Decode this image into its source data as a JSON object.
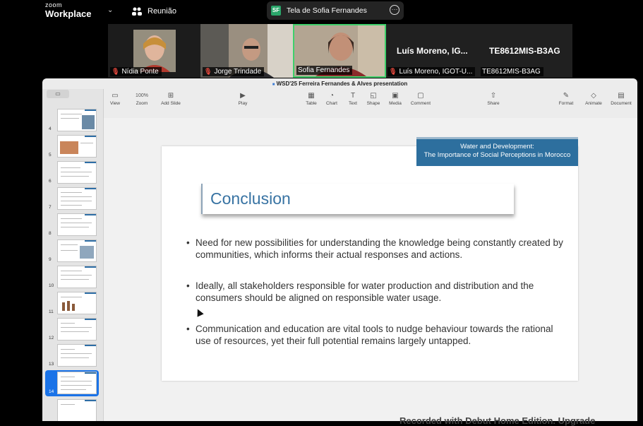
{
  "app": {
    "logo_small": "zoom",
    "logo_big": "Workplace"
  },
  "meeting": {
    "label": "Reunião",
    "chevron": "⌄"
  },
  "screen_share": {
    "badge": "SF",
    "label": "Tela de Sofia Fernandes",
    "more": "···"
  },
  "participants": [
    {
      "name": "Nídia Ponte",
      "muted": true
    },
    {
      "name": "Jorge Trindade",
      "muted": true
    },
    {
      "name": "Sofia Fernandes",
      "muted": false,
      "active_speaker": true
    },
    {
      "name": "Luís Moreno, IGOT-U...",
      "muted": true,
      "display_name": "Luís Moreno, IG..."
    },
    {
      "name": "TE8612MIS-B3AG",
      "muted": false,
      "display_name": "TE8612MIS-B3AG"
    }
  ],
  "keynote": {
    "window_title": "WSD'25 Ferreira Fernandes & Alves presentation",
    "toolbar": {
      "view": "View",
      "zoom_value": "100%",
      "zoom": "Zoom",
      "add_slide": "Add Slide",
      "play": "Play",
      "table": "Table",
      "chart": "Chart",
      "text": "Text",
      "shape": "Shape",
      "media": "Media",
      "comment": "Comment",
      "share": "Share",
      "format": "Format",
      "animate": "Animate",
      "document": "Document"
    },
    "slide_numbers": [
      "4",
      "5",
      "6",
      "7",
      "8",
      "9",
      "10",
      "11",
      "12",
      "13",
      "14"
    ],
    "selected_slide": "14"
  },
  "slide": {
    "banner_line1": "Water and Development:",
    "banner_line2": "The Importance of Social Perceptions in Morocco",
    "title": "Conclusion",
    "bullets": [
      "Need for new possibilities for understanding the knowledge being constantly created by communities, which informs their actual responses and actions.",
      "Ideally, all stakeholders responsible for water production and distribution and the consumers should be aligned on responsible water usage.",
      "Communication and education are vital tools to nudge behaviour towards the rational use of resources, yet their full potential remains largely untapped."
    ]
  },
  "watermark": "Recorded with Debut Home Edition. Upgrade"
}
